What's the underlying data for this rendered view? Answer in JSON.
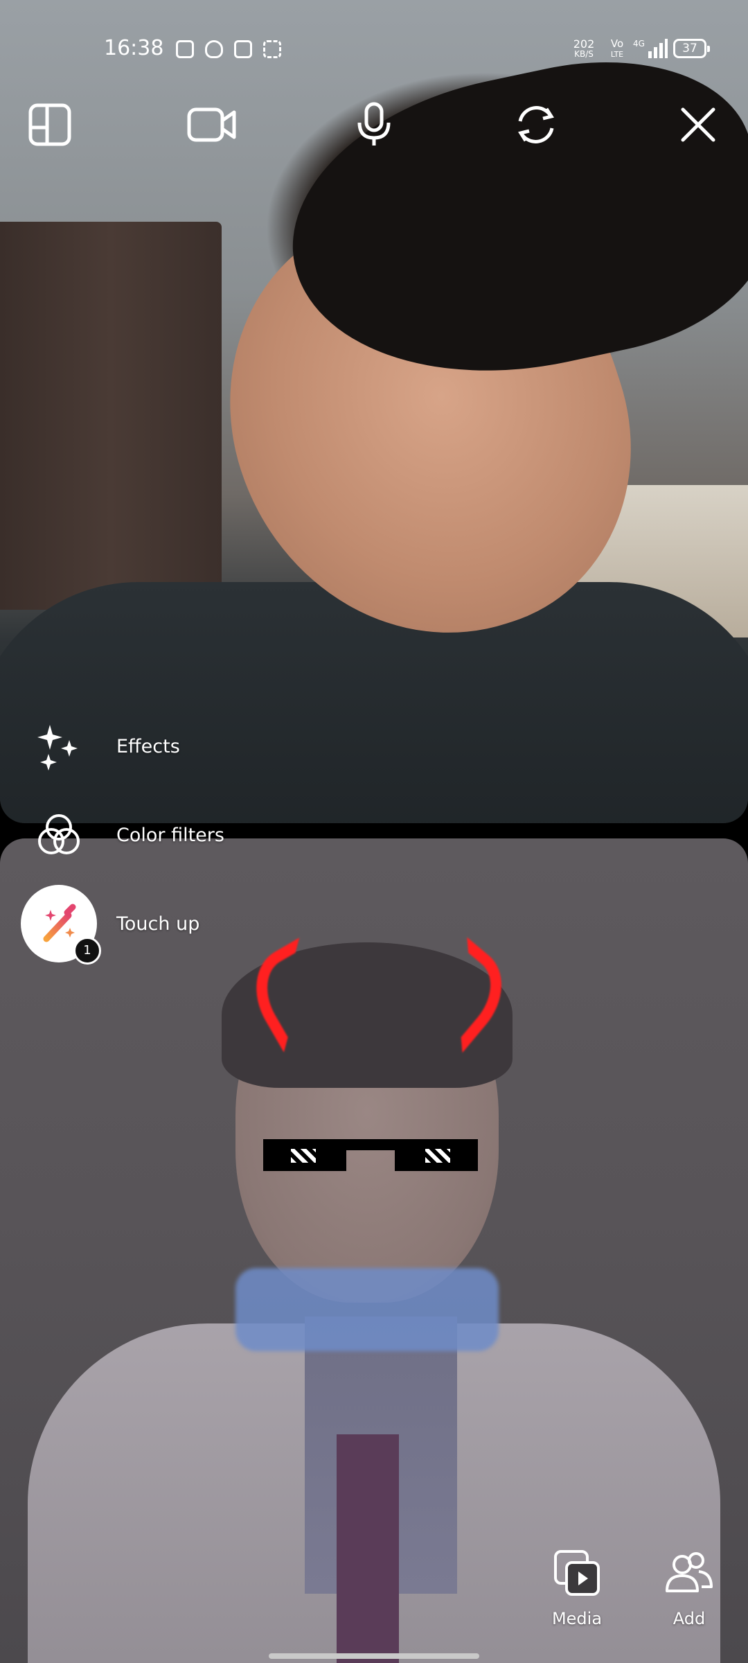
{
  "status_bar": {
    "time": "16:38",
    "network_speed": "202",
    "network_speed_unit": "KB/S",
    "volte_top": "Vo",
    "volte_bottom": "LTE",
    "network_type": "4G",
    "battery": "37"
  },
  "top_controls": {
    "layout_icon": "layout-icon",
    "camera_icon": "video-camera-icon",
    "mic_icon": "microphone-icon",
    "flip_icon": "flip-camera-icon",
    "close_icon": "close-icon"
  },
  "side_menu": {
    "effects_label": "Effects",
    "color_filters_label": "Color filters",
    "touch_up_label": "Touch up",
    "touch_up_badge": "1"
  },
  "bottom_controls": {
    "media_label": "Media",
    "add_label": "Add"
  },
  "colors": {
    "overlay_text": "#ffffff",
    "touch_up_gradient_start": "#e3456e",
    "touch_up_gradient_end": "#f7a23b",
    "horns": "#ff2020"
  }
}
